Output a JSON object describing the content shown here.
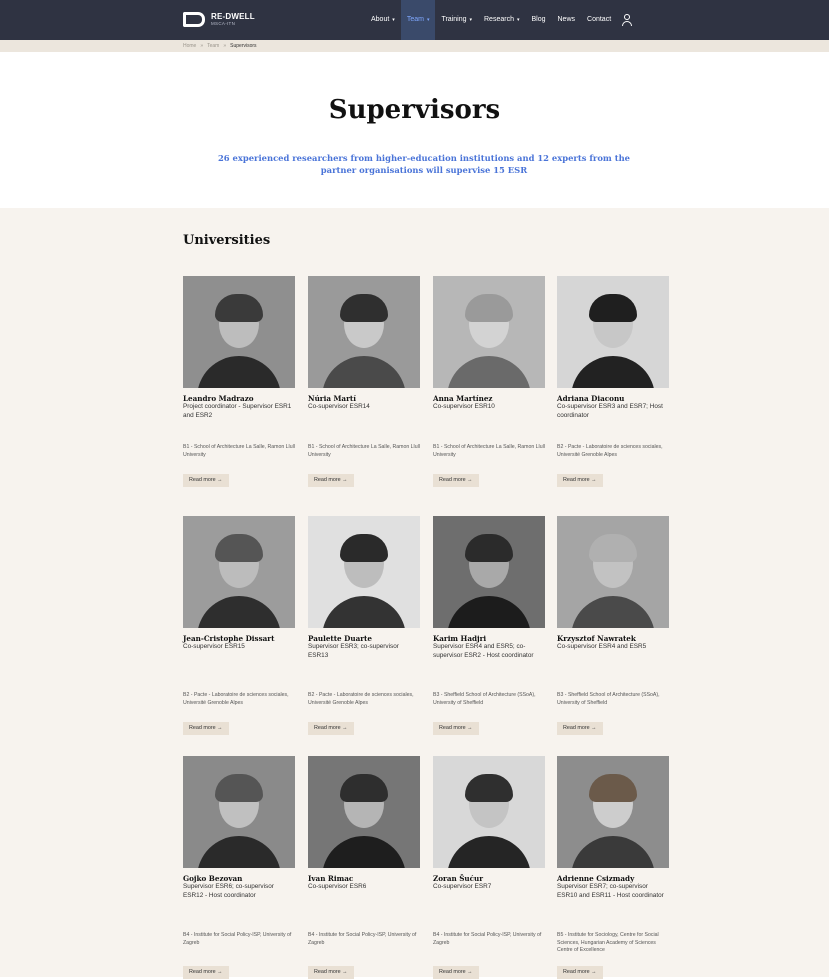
{
  "nav": {
    "logo_title": "RE-DWELL",
    "logo_sub": "MSCA-ITN",
    "items": [
      {
        "label": "About",
        "caret": "▾"
      },
      {
        "label": "Team",
        "caret": "▾"
      },
      {
        "label": "Training",
        "caret": "▾"
      },
      {
        "label": "Research",
        "caret": "▾"
      },
      {
        "label": "Blog",
        "caret": ""
      },
      {
        "label": "News",
        "caret": ""
      },
      {
        "label": "Contact",
        "caret": ""
      }
    ]
  },
  "breadcrumb": {
    "home": "Home",
    "sep": "»",
    "team": "Team",
    "current": "Supervisors"
  },
  "hero": {
    "title": "Supervisors",
    "subtitle": "26 experienced researchers from higher-education institutions and 12 experts from the partner organisations will supervise 15 ESR"
  },
  "section": {
    "title": "Universities",
    "read_more": "Read more →"
  },
  "cards": [
    {
      "name": "Leandro Madrazo",
      "role": "Project coordinator - Supervisor ESR1 and ESR2",
      "inst": "B1 - School of Architecture La Salle, Ramon Llull University"
    },
    {
      "name": "Núria Martí",
      "role": "Co-supervisor ESR14",
      "inst": "B1 - School of Architecture La Salle, Ramon Llull University"
    },
    {
      "name": "Anna Martínez",
      "role": "Co-supervisor ESR10",
      "inst": "B1 - School of Architecture La Salle, Ramon Llull University"
    },
    {
      "name": "Adriana Diaconu",
      "role": "Co-supervisor ESR3 and ESR7; Host coordinator",
      "inst": "B2 - Pacte - Laboratoire de sciences sociales, Université Grenoble Alpes"
    },
    {
      "name": "Jean-Cristophe Dissart",
      "role": "Co-supervisor ESR15",
      "inst": "B2 - Pacte - Laboratoire de sciences sociales, Université Grenoble Alpes"
    },
    {
      "name": "Paulette Duarte",
      "role": "Supervisor ESR3; co-supervisor ESR13",
      "inst": "B2 - Pacte - Laboratoire de sciences sociales, Université Grenoble Alpes"
    },
    {
      "name": "Karim Hadjri",
      "role": "Supervisor ESR4 and ESR5; co-supervisor ESR2 - Host coordinator",
      "inst": "B3 - Sheffield School of Architecture (SSoA), University of Sheffield"
    },
    {
      "name": "Krzysztof Nawratek",
      "role": "Co-supervisor ESR4 and ESR5",
      "inst": "B3 - Sheffield School of Architecture (SSoA), University of Sheffield"
    },
    {
      "name": "Gojko Bezovan",
      "role": "Supervisor ESR6; co-supervisor ESR12 - Host coordinator",
      "inst": "B4 - Institute for Social Policy-ISP, University of Zagreb"
    },
    {
      "name": "Ivan Rimac",
      "role": "Co-supervisor ESR6",
      "inst": "B4 - Institute for Social Policy-ISP, University of Zagreb"
    },
    {
      "name": "Zoran Šućur",
      "role": "Co-supervisor ESR7",
      "inst": "B4 - Institute for Social Policy-ISP, University of Zagreb"
    },
    {
      "name": "Adrienne Csizmady",
      "role": "Supervisor ESR7; co-supervisor ESR10 and ESR11 - Host coordinator",
      "inst": "B5 - Institute for Sociology, Centre for Social Sciences, Hungarian Academy of Sciences Centre of Excellence"
    }
  ],
  "icons": {
    "user": "user-icon",
    "arrow": "arrow-right-icon"
  },
  "colors": {
    "nav_bg": "#2f3342",
    "accent": "#4a74d8",
    "active_nav": "#7fa8ff",
    "section_bg": "#f7f3ee",
    "button_bg": "#e9e0d4"
  }
}
